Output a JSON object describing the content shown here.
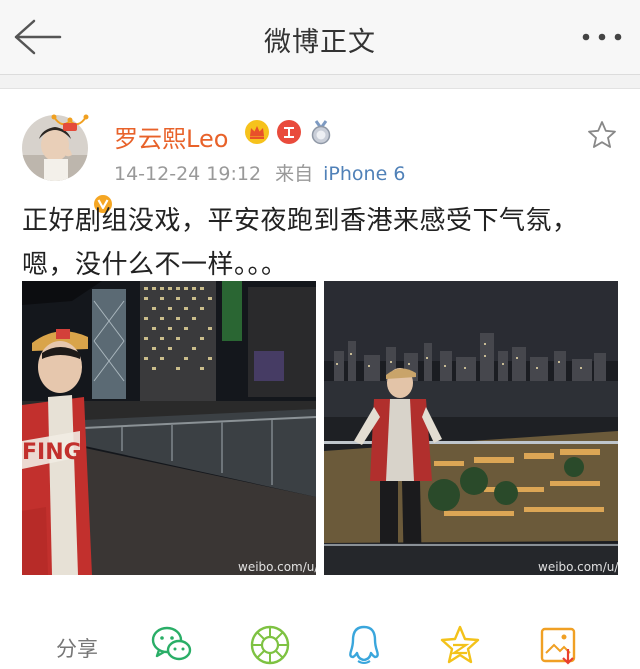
{
  "nav": {
    "title": "微博正文",
    "back_icon": "arrow-left-icon",
    "more_icon": "more-dots-icon"
  },
  "post": {
    "author": "罗云熙Leo",
    "badges": [
      "crown-badge-icon",
      "red-badge-icon",
      "medal-badge-icon"
    ],
    "timestamp": "14-12-24 19:12",
    "source_prefix": "来自",
    "source": "iPhone 6",
    "text_line1": "正好剧组没戏，平安夜跑到香港来感受下气氛，",
    "text_line2": "嗯，没什么不一样。。。",
    "photos": [
      {
        "watermark": "weibo.com/u/"
      },
      {
        "watermark": "weibo.com/u/"
      }
    ]
  },
  "actions": {
    "share_label": "分享",
    "icons": [
      "wechat-icon",
      "moments-icon",
      "qq-icon",
      "qzone-star-icon",
      "save-image-icon"
    ]
  },
  "colors": {
    "author": "#e8622a",
    "source": "#5081b8",
    "wechat": "#2aae67",
    "moments": "#7ec242",
    "qq": "#3aa6dc",
    "qzone": "#f3c21a",
    "save": "#f0a024"
  }
}
